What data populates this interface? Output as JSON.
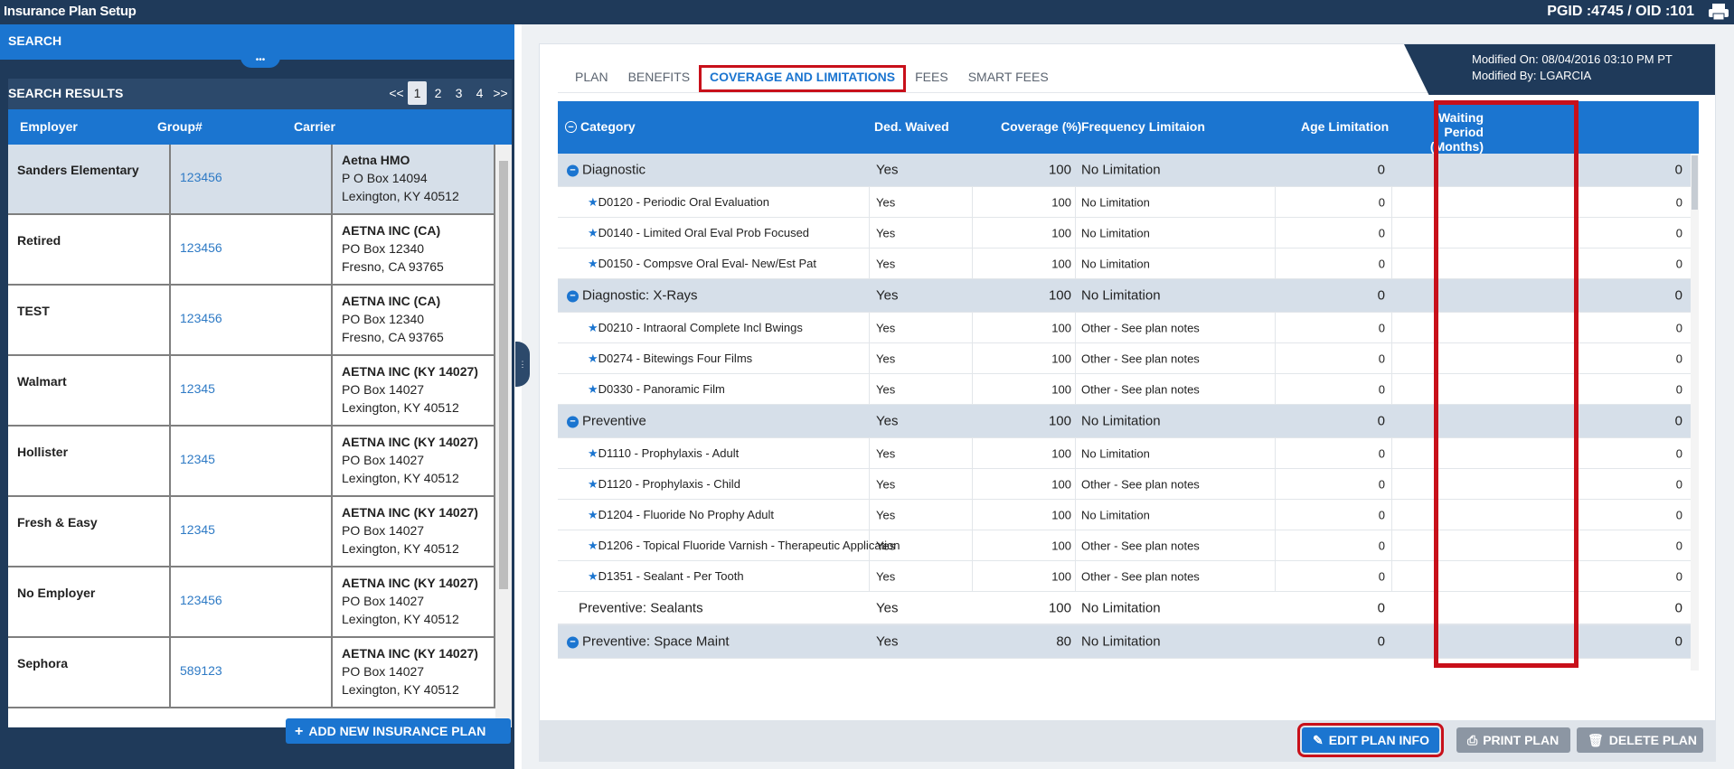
{
  "app": {
    "title": "Insurance Plan Setup",
    "ids": "PGID :4745  /  OID :101"
  },
  "search": {
    "header": "SEARCH",
    "collapse_glyph": "•••"
  },
  "results": {
    "title": "SEARCH RESULTS",
    "pager": [
      "<<",
      "1",
      "2",
      "3",
      "4",
      ">>"
    ],
    "columns": [
      "Employer",
      "Group#",
      "Carrier"
    ],
    "rows": [
      {
        "employer": "Sanders Elementary",
        "group": "123456",
        "carrier_name": "Aetna HMO",
        "addr1": "P O Box 14094",
        "addr2": "Lexington, KY 40512"
      },
      {
        "employer": "Retired",
        "group": "123456",
        "carrier_name": "AETNA INC (CA)",
        "addr1": "PO Box 12340",
        "addr2": "Fresno, CA 93765"
      },
      {
        "employer": "TEST",
        "group": "123456",
        "carrier_name": "AETNA INC (CA)",
        "addr1": "PO Box 12340",
        "addr2": "Fresno, CA 93765"
      },
      {
        "employer": "Walmart",
        "group": "12345",
        "carrier_name": "AETNA INC (KY 14027)",
        "addr1": "PO Box 14027",
        "addr2": "Lexington, KY 40512"
      },
      {
        "employer": "Hollister",
        "group": "12345",
        "carrier_name": "AETNA INC (KY 14027)",
        "addr1": "PO Box 14027",
        "addr2": "Lexington, KY 40512"
      },
      {
        "employer": "Fresh & Easy",
        "group": "12345",
        "carrier_name": "AETNA INC (KY 14027)",
        "addr1": "PO Box 14027",
        "addr2": "Lexington, KY 40512"
      },
      {
        "employer": "No Employer",
        "group": "123456",
        "carrier_name": "AETNA INC (KY 14027)",
        "addr1": "PO Box 14027",
        "addr2": "Lexington, KY 40512"
      },
      {
        "employer": "Sephora",
        "group": "589123",
        "carrier_name": "AETNA INC (KY 14027)",
        "addr1": "PO Box 14027",
        "addr2": "Lexington, KY 40512"
      }
    ],
    "add_button": "ADD NEW INSURANCE PLAN"
  },
  "tabs": [
    "PLAN",
    "BENEFITS",
    "COVERAGE AND LIMITATIONS",
    "FEES",
    "SMART FEES"
  ],
  "modified": {
    "on": "Modified On: 08/04/2016 03:10 PM PT",
    "by": "Modified By: LGARCIA"
  },
  "coverage": {
    "columns": {
      "category": "Category",
      "ded": "Ded. Waived",
      "coverage": "Coverage (%)",
      "frequency": "Frequency Limitaion",
      "age": "Age Limitation",
      "waiting1": "Waiting Period",
      "waiting2": "(Months)"
    },
    "rows": [
      {
        "type": "cat",
        "name": "Diagnostic",
        "ded": "Yes",
        "cov": "100",
        "freq": "No Limitation",
        "age": "0",
        "wait": "0"
      },
      {
        "type": "proc",
        "name": "D0120 - Periodic Oral Evaluation",
        "ded": "Yes",
        "cov": "100",
        "freq": "No Limitation",
        "age": "0",
        "wait": "0"
      },
      {
        "type": "proc",
        "name": "D0140 - Limited Oral Eval Prob Focused",
        "ded": "Yes",
        "cov": "100",
        "freq": "No Limitation",
        "age": "0",
        "wait": "0"
      },
      {
        "type": "proc",
        "name": "D0150 - Compsve Oral Eval- New/Est Pat",
        "ded": "Yes",
        "cov": "100",
        "freq": "No Limitation",
        "age": "0",
        "wait": "0"
      },
      {
        "type": "cat",
        "name": "Diagnostic: X-Rays",
        "ded": "Yes",
        "cov": "100",
        "freq": "No Limitation",
        "age": "0",
        "wait": "0"
      },
      {
        "type": "proc",
        "name": "D0210 - Intraoral Complete Incl Bwings",
        "ded": "Yes",
        "cov": "100",
        "freq": "Other - See plan notes",
        "age": "0",
        "wait": "0"
      },
      {
        "type": "proc",
        "name": "D0274 - Bitewings Four Films",
        "ded": "Yes",
        "cov": "100",
        "freq": "Other - See plan notes",
        "age": "0",
        "wait": "0"
      },
      {
        "type": "proc",
        "name": "D0330 - Panoramic Film",
        "ded": "Yes",
        "cov": "100",
        "freq": "Other - See plan notes",
        "age": "0",
        "wait": "0"
      },
      {
        "type": "cat",
        "name": "Preventive",
        "ded": "Yes",
        "cov": "100",
        "freq": "No Limitation",
        "age": "0",
        "wait": "0"
      },
      {
        "type": "proc",
        "name": "D1110 - Prophylaxis - Adult",
        "ded": "Yes",
        "cov": "100",
        "freq": "No Limitation",
        "age": "0",
        "wait": "0"
      },
      {
        "type": "proc",
        "name": "D1120 - Prophylaxis - Child",
        "ded": "Yes",
        "cov": "100",
        "freq": "Other - See plan notes",
        "age": "0",
        "wait": "0"
      },
      {
        "type": "proc",
        "name": "D1204 - Fluoride No Prophy Adult",
        "ded": "Yes",
        "cov": "100",
        "freq": "No Limitation",
        "age": "0",
        "wait": "0"
      },
      {
        "type": "proc",
        "name": "D1206 - Topical Fluoride Varnish - Therapeutic Application",
        "ded": "Yes",
        "cov": "100",
        "freq": "Other - See plan notes",
        "age": "0",
        "wait": "0"
      },
      {
        "type": "proc",
        "name": "D1351 - Sealant - Per Tooth",
        "ded": "Yes",
        "cov": "100",
        "freq": "Other - See plan notes",
        "age": "0",
        "wait": "0"
      },
      {
        "type": "plain",
        "name": "Preventive: Sealants",
        "ded": "Yes",
        "cov": "100",
        "freq": "No Limitation",
        "age": "0",
        "wait": "0"
      },
      {
        "type": "cat",
        "name": "Preventive: Space Maint",
        "ded": "Yes",
        "cov": "80",
        "freq": "No Limitation",
        "age": "0",
        "wait": "0"
      }
    ]
  },
  "footer": {
    "edit": "EDIT PLAN INFO",
    "print": "PRINT PLAN",
    "delete": "DELETE PLAN"
  },
  "icons": {
    "printer": "printer-icon",
    "pencil": "pencil-icon",
    "trash": "trash-icon",
    "plus": "plus-icon",
    "minus": "minus-circle-icon",
    "star": "star-icon"
  },
  "colors": {
    "nav": "#1f3a5a",
    "accent": "#1b75d0",
    "highlight": "#c8101a",
    "row_category": "#d6dfe9"
  }
}
